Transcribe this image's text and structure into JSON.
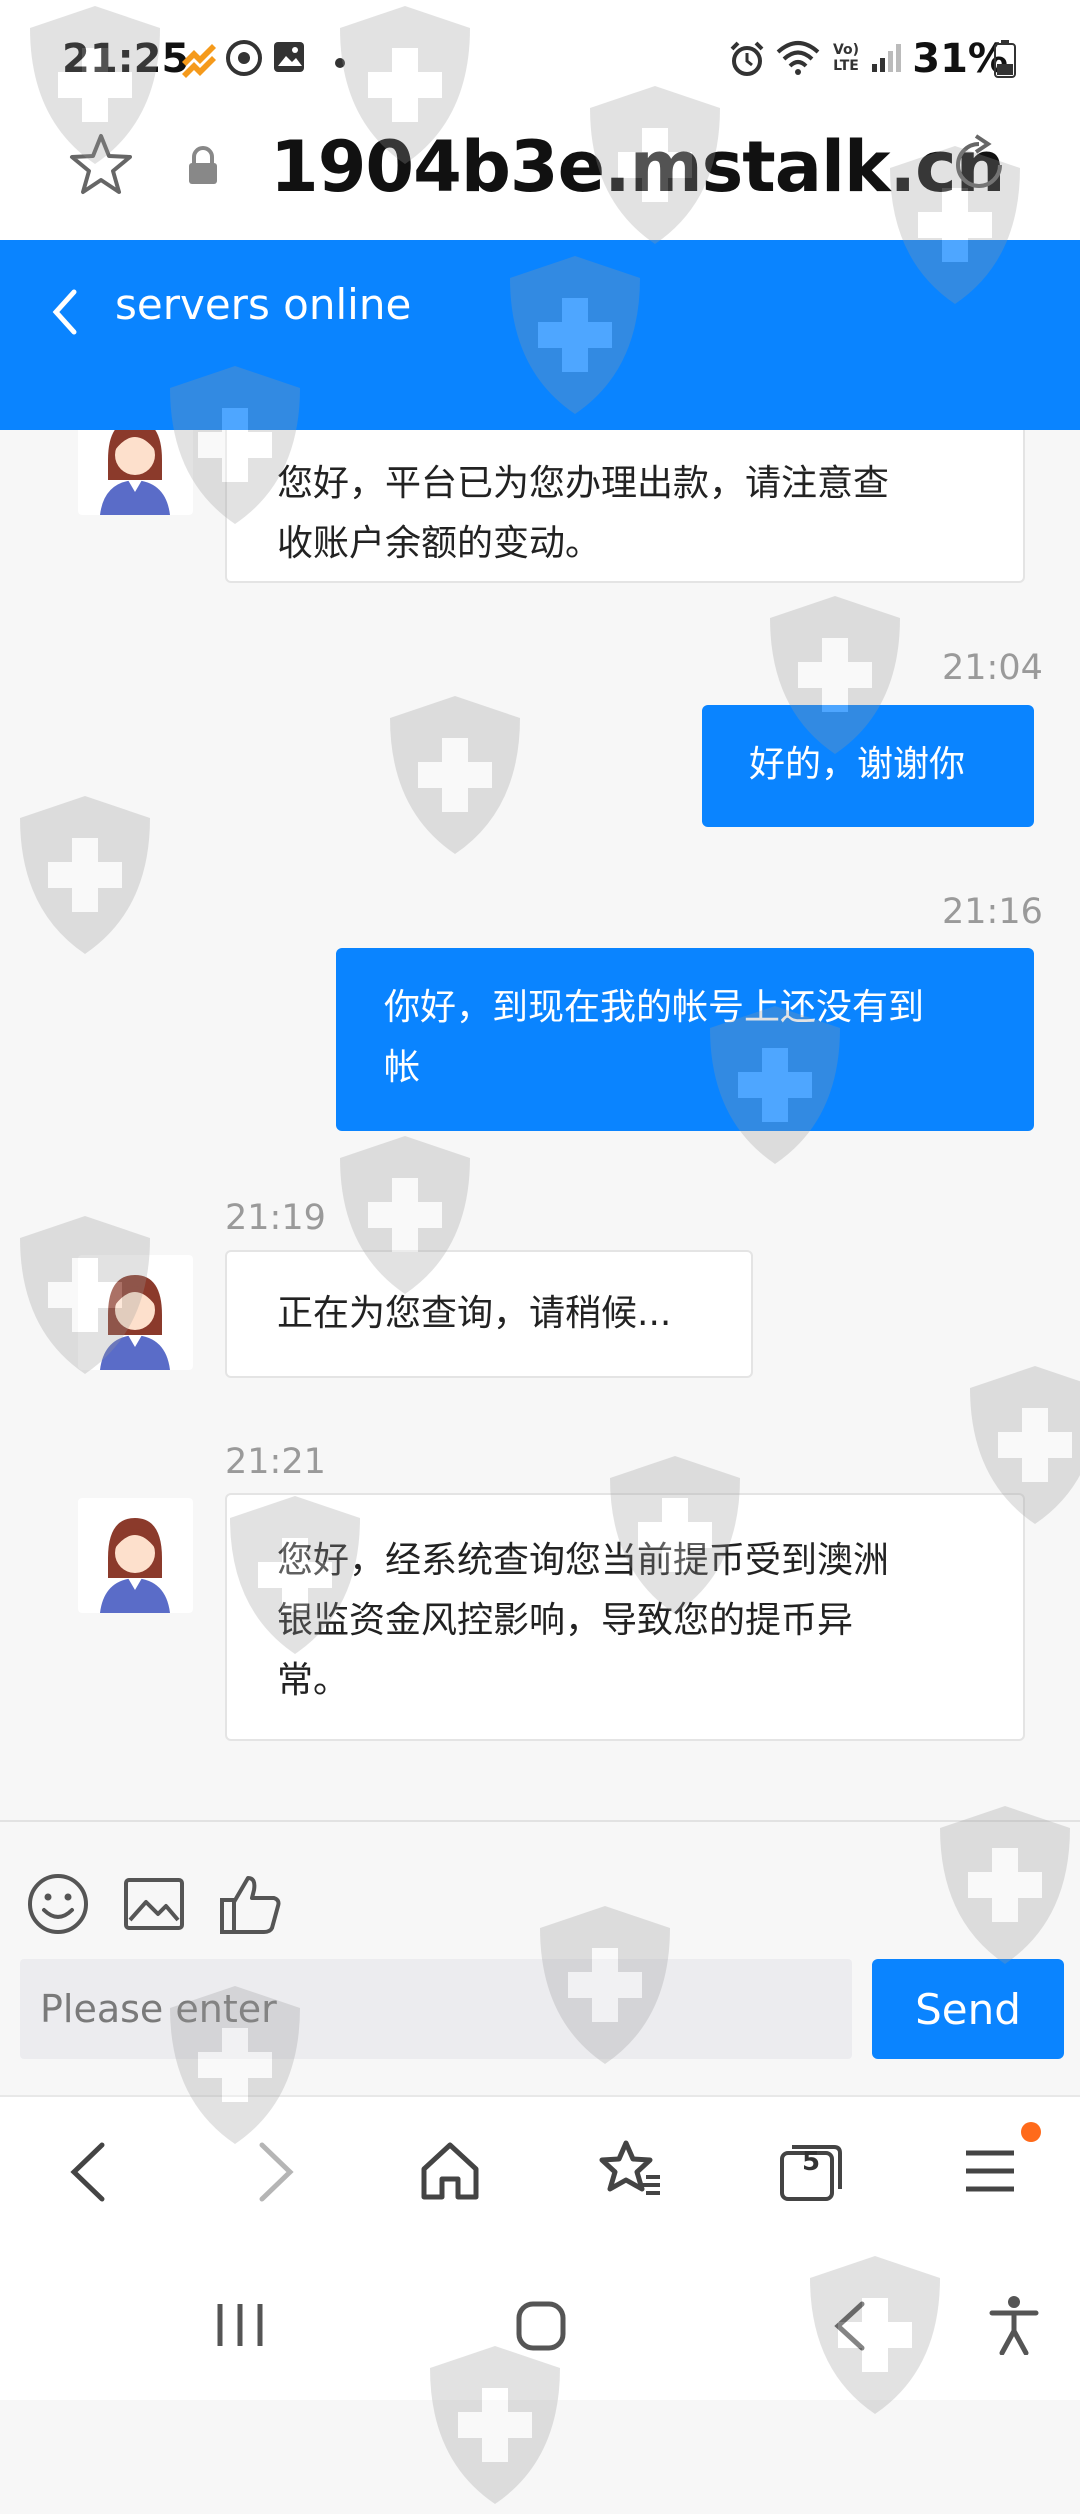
{
  "status_bar": {
    "time": "21:25",
    "battery": "31%",
    "network_label": "Vo) LTE"
  },
  "address_bar": {
    "url": "1904b3e.mstalk.cn"
  },
  "chat_header": {
    "title": "servers online"
  },
  "messages": [
    {
      "from": "agent",
      "time": "",
      "text_lines": [
        "您好，平台已为您办理出款，请注意查",
        "收账户余额的变动。"
      ]
    },
    {
      "from": "user",
      "time": "21:04",
      "text_lines": [
        "好的，谢谢你"
      ]
    },
    {
      "from": "user",
      "time": "21:16",
      "text_lines": [
        "你好，到现在我的帐号上还没有到",
        "帐"
      ]
    },
    {
      "from": "agent",
      "time": "21:19",
      "text_lines": [
        "正在为您查询，请稍候..."
      ]
    },
    {
      "from": "agent",
      "time": "21:21",
      "text_lines": [
        "您好，经系统查询您当前提币受到澳洲",
        "银监资金风控影响，导致您的提币异",
        "常。"
      ]
    }
  ],
  "composer": {
    "placeholder": "Please enter",
    "send_label": "Send",
    "tools": [
      "emoji-icon",
      "image-icon",
      "thumbs-up-icon"
    ]
  },
  "browser_nav": {
    "tab_count": "5",
    "icons": [
      "back-icon",
      "forward-icon",
      "home-icon",
      "bookmarks-icon",
      "tabs-icon",
      "menu-icon"
    ]
  },
  "colors": {
    "accent": "#0a84ff",
    "background": "#f7f7f7",
    "bubble_in": "#ffffff",
    "notification_dot": "#ff6a1a"
  }
}
